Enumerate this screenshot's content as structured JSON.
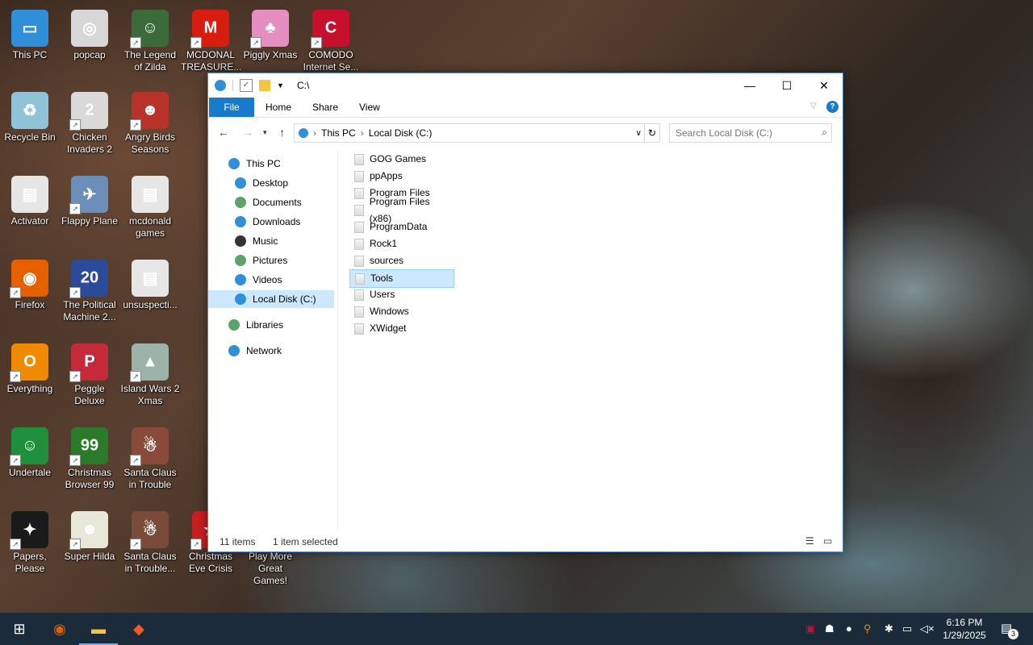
{
  "desktop_icons": [
    {
      "label": "This PC",
      "color": "#2f8fd8",
      "glyph": "▭",
      "shortcut": false
    },
    {
      "label": "popcap",
      "color": "#d7d7d7",
      "glyph": "◎",
      "shortcut": false
    },
    {
      "label": "The Legend of Zilda",
      "color": "#3b6b3a",
      "glyph": "☺",
      "shortcut": true
    },
    {
      "label": "MCDONAL TREASURE...",
      "color": "#d91c10",
      "glyph": "M",
      "shortcut": true
    },
    {
      "label": "Piggly Xmas",
      "color": "#e58fc0",
      "glyph": "♣",
      "shortcut": true
    },
    {
      "label": "COMODO Internet Se...",
      "color": "#c8102e",
      "glyph": "C",
      "shortcut": true
    },
    {
      "label": "Recycle Bin",
      "color": "#8fc3d8",
      "glyph": "♻",
      "shortcut": false
    },
    {
      "label": "Chicken Invaders 2",
      "color": "#d9d9d9",
      "glyph": "2",
      "shortcut": true
    },
    {
      "label": "Angry Birds Seasons",
      "color": "#b8322a",
      "glyph": "☻",
      "shortcut": true
    },
    {
      "label": "Activator",
      "color": "#e6e6e6",
      "glyph": "▤",
      "shortcut": false
    },
    {
      "label": "Flappy Plane",
      "color": "#6b8fb8",
      "glyph": "✈",
      "shortcut": true
    },
    {
      "label": "mcdonald games",
      "color": "#e6e6e6",
      "glyph": "▤",
      "shortcut": false
    },
    {
      "label": "Firefox",
      "color": "#e66000",
      "glyph": "◉",
      "shortcut": true
    },
    {
      "label": "The Political Machine 2...",
      "color": "#2c4a9a",
      "glyph": "20",
      "shortcut": true
    },
    {
      "label": "unsuspecti...",
      "color": "#e6e6e6",
      "glyph": "▤",
      "shortcut": false
    },
    {
      "label": "Everything",
      "color": "#f08a00",
      "glyph": "O",
      "shortcut": true
    },
    {
      "label": "Peggle Deluxe",
      "color": "#c42a3a",
      "glyph": "P",
      "shortcut": true
    },
    {
      "label": "Island Wars 2 Xmas",
      "color": "#9bb3a8",
      "glyph": "▲",
      "shortcut": true
    },
    {
      "label": "Undertale",
      "color": "#1e8f3a",
      "glyph": "☺",
      "shortcut": true
    },
    {
      "label": "Christmas Browser 99",
      "color": "#2a7a2a",
      "glyph": "99",
      "shortcut": true
    },
    {
      "label": "Santa Claus in Trouble",
      "color": "#8a4a3a",
      "glyph": "☃",
      "shortcut": true
    },
    {
      "label": "Papers, Please",
      "color": "#1a1a1a",
      "glyph": "✦",
      "shortcut": true
    },
    {
      "label": "Super Hilda",
      "color": "#e8e8d8",
      "glyph": "☻",
      "shortcut": true
    },
    {
      "label": "Santa Claus in Trouble...",
      "color": "#7a4a3a",
      "glyph": "☃",
      "shortcut": true
    },
    {
      "label": "Christmas Eve Crisis",
      "color": "#c82020",
      "glyph": "★",
      "shortcut": true
    },
    {
      "label": "Play More Great Games!",
      "color": "#3a3a3a",
      "glyph": "",
      "shortcut": false
    }
  ],
  "explorer": {
    "path_title": "C:\\",
    "window_controls": {
      "minimize": "—",
      "maximize": "☐",
      "close": "✕"
    },
    "ribbon_tabs": [
      "File",
      "Home",
      "Share",
      "View"
    ],
    "breadcrumb": [
      "This PC",
      "Local Disk (C:)"
    ],
    "search_placeholder": "Search Local Disk (C:)",
    "nav_pane": [
      {
        "label": "This PC",
        "level": 0,
        "color": "#2f8fd8"
      },
      {
        "label": "Desktop",
        "level": 1,
        "color": "#2f8fd8"
      },
      {
        "label": "Documents",
        "level": 1,
        "color": "#5aa36a"
      },
      {
        "label": "Downloads",
        "level": 1,
        "color": "#2f8fd8"
      },
      {
        "label": "Music",
        "level": 1,
        "color": "#333333"
      },
      {
        "label": "Pictures",
        "level": 1,
        "color": "#5aa36a"
      },
      {
        "label": "Videos",
        "level": 1,
        "color": "#2f8fd8"
      },
      {
        "label": "Local Disk (C:)",
        "level": 1,
        "color": "#2f8fd8",
        "selected": true
      },
      {
        "label": "Libraries",
        "level": 0,
        "color": "#5aa36a"
      },
      {
        "label": "Network",
        "level": 0,
        "color": "#2f8fd8"
      }
    ],
    "files": [
      {
        "name": "GOG Games"
      },
      {
        "name": "ppApps"
      },
      {
        "name": "Program Files"
      },
      {
        "name": "Program Files (x86)"
      },
      {
        "name": "ProgramData"
      },
      {
        "name": "Rock1"
      },
      {
        "name": "sources"
      },
      {
        "name": "Tools",
        "selected": true
      },
      {
        "name": "Users"
      },
      {
        "name": "Windows"
      },
      {
        "name": "XWidget"
      }
    ],
    "status": {
      "count": "11 items",
      "selection": "1 item selected"
    }
  },
  "taskbar": {
    "start_icon": "windows-start-icon",
    "clock": {
      "time": "6:16 PM",
      "date": "1/29/2025"
    },
    "notification_count": "3"
  }
}
